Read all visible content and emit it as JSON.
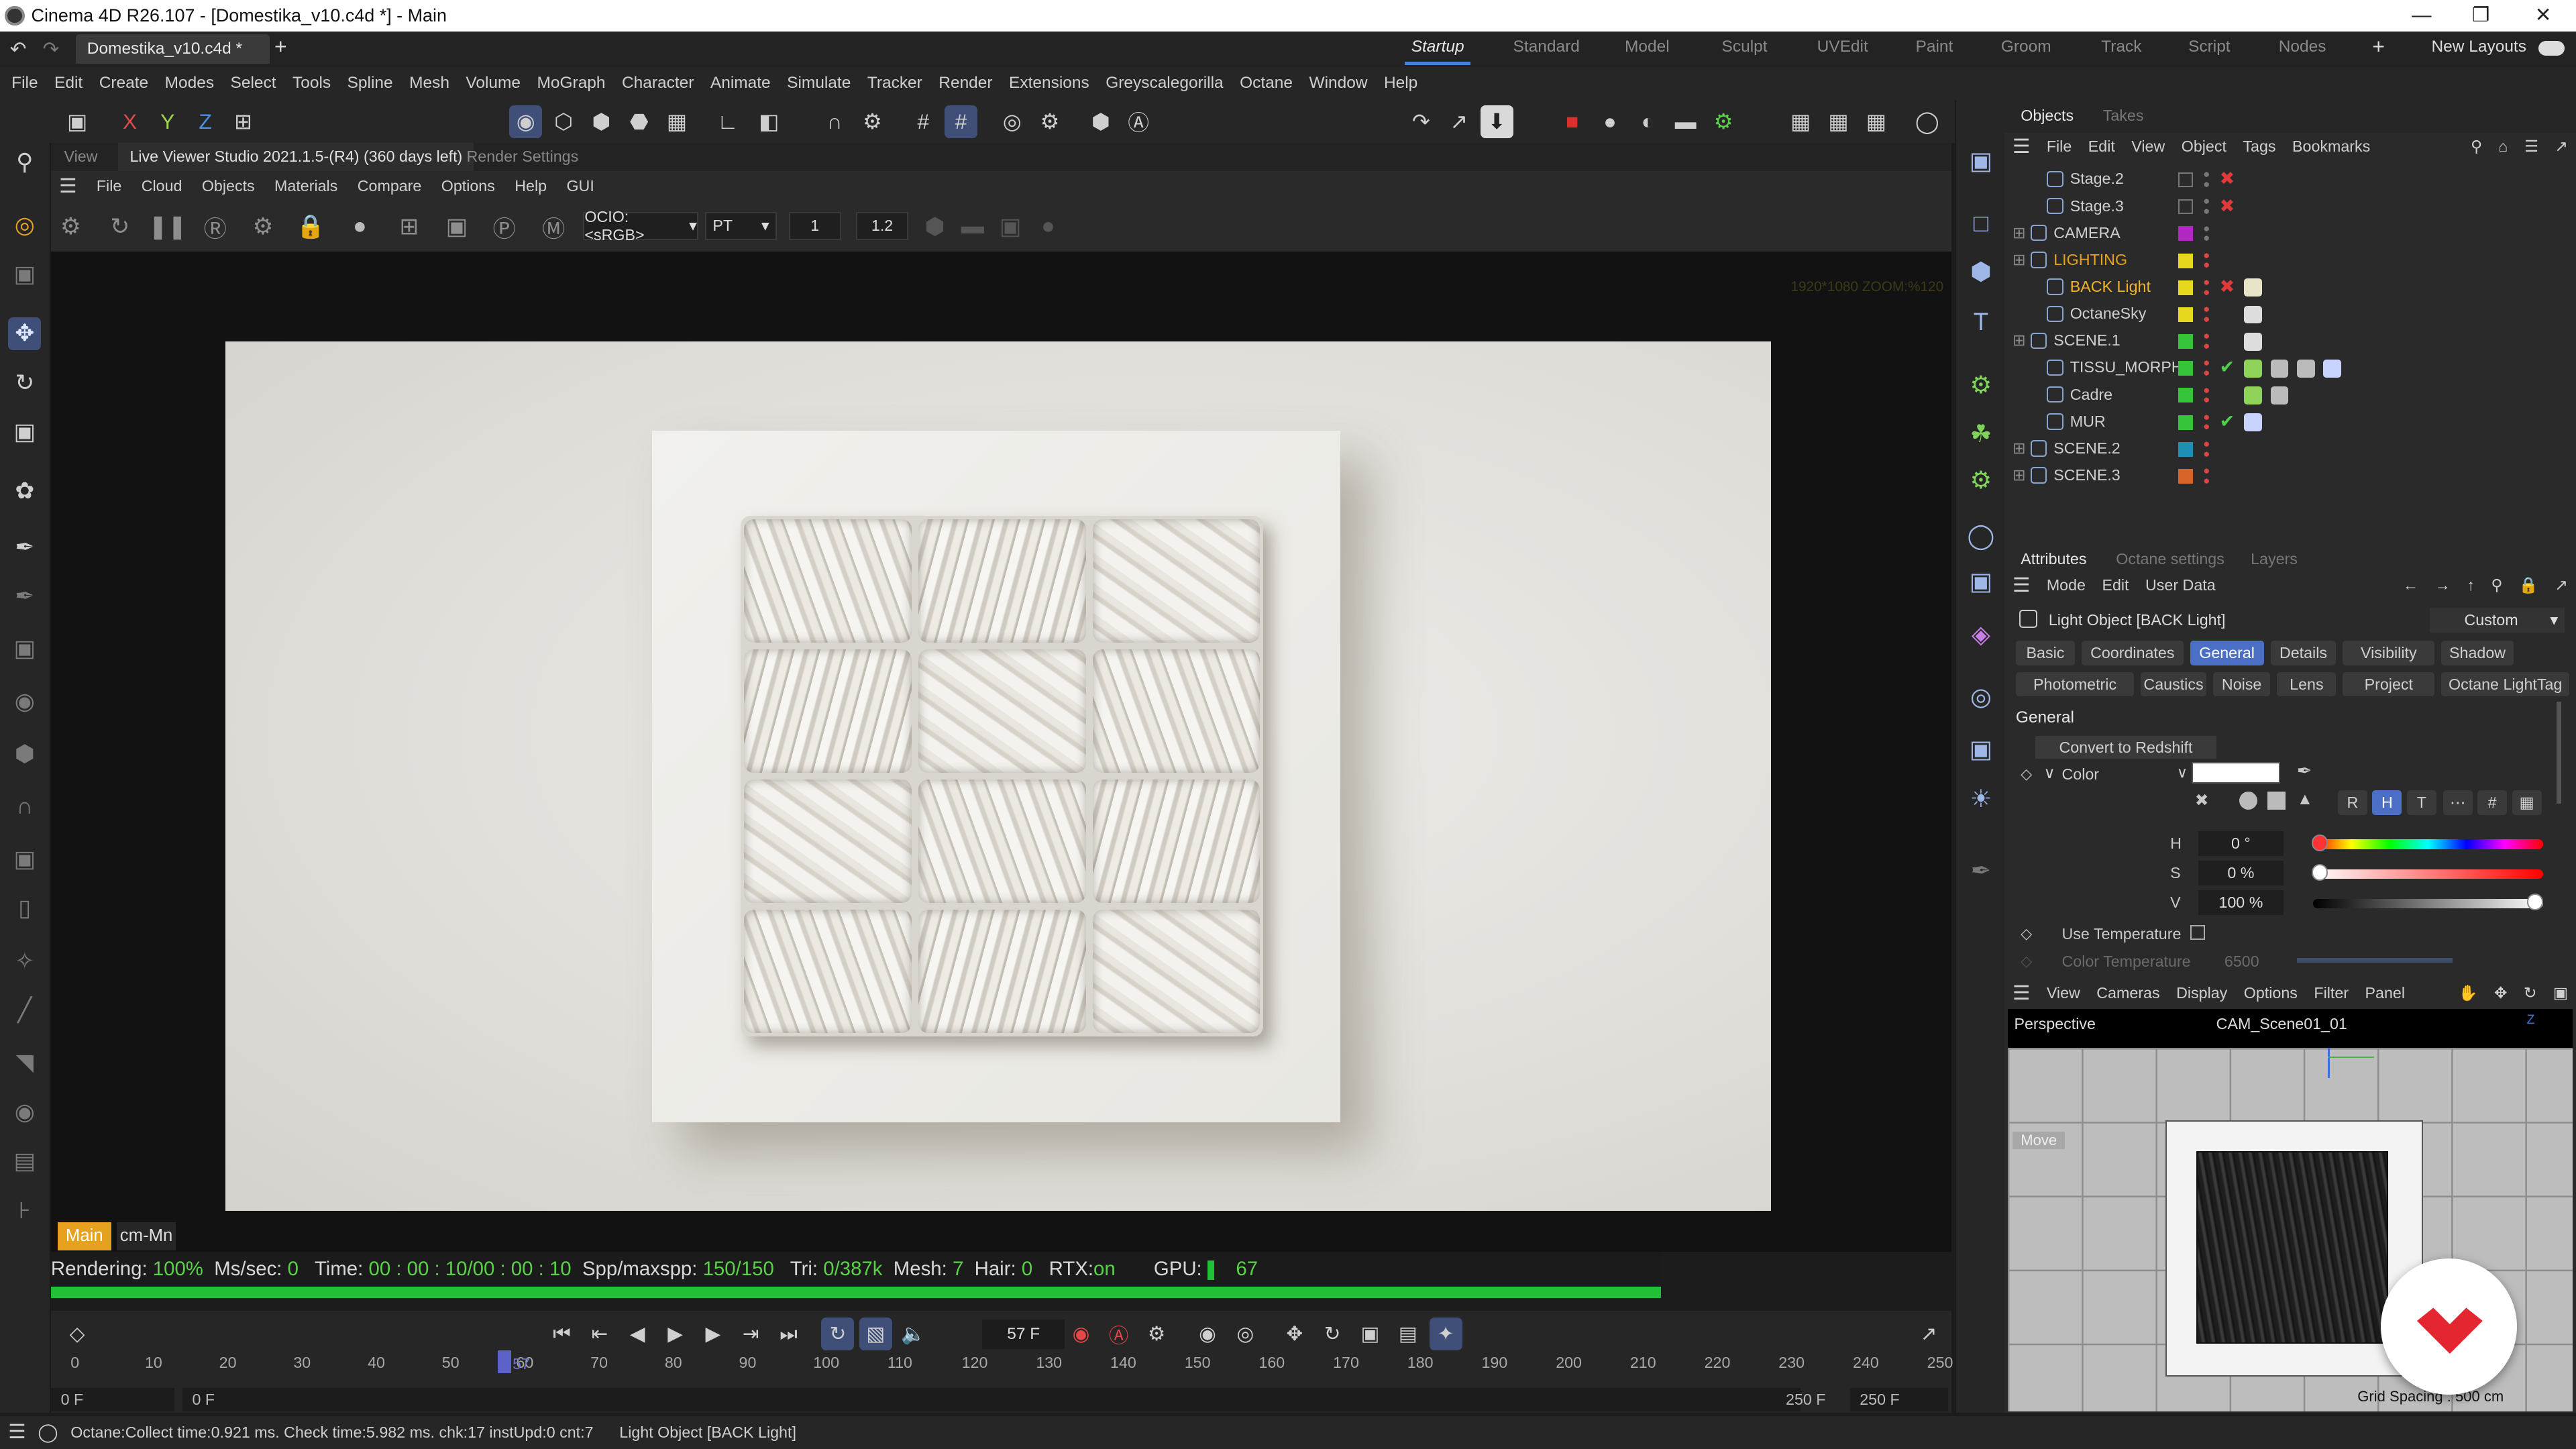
{
  "window": {
    "title": "Cinema 4D R26.107 - [Domestika_v10.c4d *] - Main"
  },
  "filetab": {
    "name": "Domestika_v10.c4d *"
  },
  "layouts": [
    {
      "label": "Startup",
      "active": true
    },
    {
      "label": "Standard"
    },
    {
      "label": "Model"
    },
    {
      "label": "Sculpt"
    },
    {
      "label": "UVEdit"
    },
    {
      "label": "Paint"
    },
    {
      "label": "Groom"
    },
    {
      "label": "Track"
    },
    {
      "label": "Script"
    },
    {
      "label": "Nodes"
    }
  ],
  "new_layouts": "New Layouts",
  "menu": [
    "File",
    "Edit",
    "Create",
    "Modes",
    "Select",
    "Tools",
    "Spline",
    "Mesh",
    "Volume",
    "MoGraph",
    "Character",
    "Animate",
    "Simulate",
    "Tracker",
    "Render",
    "Extensions",
    "Greyscalegorilla",
    "Octane",
    "Window",
    "Help"
  ],
  "axes": {
    "x": "X",
    "y": "Y",
    "z": "Z"
  },
  "viewer": {
    "tab_view": "View",
    "title": "Live Viewer Studio 2021.1.5-(R4) (360 days left)",
    "render_settings": "Render Settings",
    "menu": [
      "File",
      "Cloud",
      "Objects",
      "Materials",
      "Compare",
      "Options",
      "Help",
      "GUI"
    ],
    "ocio": "OCIO:<sRGB>",
    "kernel": "PT",
    "field1": "1",
    "field2": "1.2",
    "faint_info": "1920*1080 ZOOM:%120",
    "tabs": {
      "main": "Main",
      "cm": "cm-Mn"
    },
    "status": {
      "rendering_label": "Rendering:",
      "rendering": "100%",
      "ms_label": "Ms/sec:",
      "ms": "0",
      "time_label": "Time:",
      "time": "00 : 00 : 10/00 : 00 : 10",
      "spp_label": "Spp/maxspp:",
      "spp": "150/150",
      "tri_label": "Tri:",
      "tri": "0/387k",
      "mesh_label": "Mesh:",
      "mesh": "7",
      "hair_label": "Hair:",
      "hair": "0",
      "rtx_label": "RTX:",
      "rtx": "on",
      "gpu_label": "GPU:",
      "gpu": "67"
    },
    "progress": 1.0
  },
  "timeline": {
    "current_frame": "57 F",
    "playhead_label": "57",
    "ticks": [
      "0",
      "10",
      "20",
      "30",
      "40",
      "50",
      "60",
      "70",
      "80",
      "90",
      "100",
      "110",
      "120",
      "130",
      "140",
      "150",
      "160",
      "170",
      "180",
      "190",
      "200",
      "210",
      "220",
      "230",
      "240",
      "250"
    ],
    "start_a": "0 F",
    "start_b": "0 F",
    "end_a": "250 F",
    "end_b": "250 F"
  },
  "statusbar": {
    "log": "Octane:Collect time:0.921 ms.  Check time:5.982 ms.  chk:17  instUpd:0  cnt:7",
    "selection": "Light Object [BACK Light]"
  },
  "objects_panel": {
    "tabs": {
      "objects": "Objects",
      "takes": "Takes"
    },
    "menu": [
      "File",
      "Edit",
      "View",
      "Object",
      "Tags",
      "Bookmarks"
    ],
    "rows": [
      {
        "name": "Stage.2",
        "color": "",
        "state": "x",
        "indent": 1
      },
      {
        "name": "Stage.3",
        "color": "",
        "state": "x",
        "indent": 1
      },
      {
        "name": "CAMERA",
        "color": "#b027c4",
        "state": "",
        "indent": 0
      },
      {
        "name": "LIGHTING",
        "color": "#e6d81d",
        "state": "",
        "indent": 0,
        "highlight": "#e6a21f"
      },
      {
        "name": "BACK Light",
        "color": "#e6d81d",
        "state": "x",
        "indent": 1,
        "highlight": "#f0b429"
      },
      {
        "name": "OctaneSky",
        "color": "#e6d81d",
        "state": "",
        "indent": 1
      },
      {
        "name": "SCENE.1",
        "color": "#35c43a",
        "state": "",
        "indent": 0
      },
      {
        "name": "TISSU_MORPH",
        "color": "#35c43a",
        "state": "check",
        "indent": 1
      },
      {
        "name": "Cadre",
        "color": "#35c43a",
        "state": "",
        "indent": 1
      },
      {
        "name": "MUR",
        "color": "#35c43a",
        "state": "check",
        "indent": 1
      },
      {
        "name": "SCENE.2",
        "color": "#1f8fb3",
        "state": "",
        "indent": 0
      },
      {
        "name": "SCENE.3",
        "color": "#d8642a",
        "state": "",
        "indent": 0
      }
    ]
  },
  "attributes": {
    "tabs": {
      "attributes": "Attributes",
      "octane": "Octane settings",
      "layers": "Layers"
    },
    "menu": [
      "Mode",
      "Edit",
      "User Data"
    ],
    "object_title": "Light Object [BACK Light]",
    "preset": "Custom",
    "buttons_row1": [
      "Basic",
      "Coordinates",
      "General",
      "Details",
      "Visibility",
      "Shadow"
    ],
    "buttons_row2": [
      "Photometric",
      "Caustics",
      "Noise",
      "Lens",
      "Project",
      "Octane LightTag"
    ],
    "selected_button": "General",
    "section": "General",
    "convert": "Convert to Redshift",
    "color_label": "Color",
    "color_value": "#ffffff",
    "mode_buttons": [
      "R",
      "H",
      "T",
      "#"
    ],
    "h_label": "H",
    "h": "0 °",
    "s_label": "S",
    "s": "0 %",
    "v_label": "V",
    "v": "100 %",
    "v_fraction": 1.0,
    "use_temp": "Use Temperature",
    "color_temp_label": "Color Temperature",
    "color_temp": "6500"
  },
  "perspective_panel": {
    "menu": [
      "View",
      "Cameras",
      "Display",
      "Options",
      "Filter",
      "Panel"
    ],
    "name": "Perspective",
    "camera": "CAM_Scene01_01",
    "move": "Move",
    "grid_spacing": "Grid Spacing : 500 cm"
  },
  "colors": {
    "accent": "#4a6fc4",
    "orange": "#e6a21f",
    "render_green": "#21c137",
    "brand_red": "#e3262f"
  }
}
